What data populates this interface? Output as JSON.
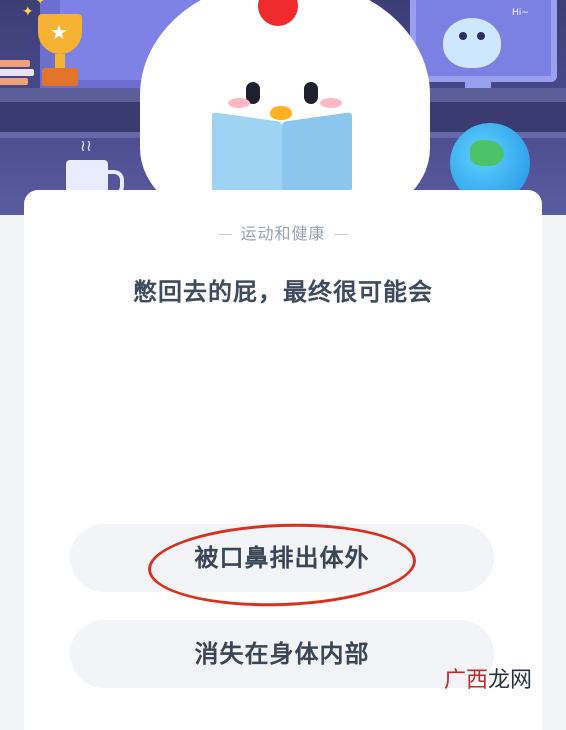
{
  "banner": {
    "monitor_greeting": "Hi~"
  },
  "quiz": {
    "category": "运动和健康",
    "question": "憋回去的屁，最终很可能会",
    "options": [
      {
        "label": "被口鼻排出体外",
        "circled": true
      },
      {
        "label": "消失在身体内部",
        "circled": false
      }
    ]
  },
  "watermark": {
    "part1": "广西",
    "part2": "龙网"
  },
  "colors": {
    "scene_bg": "#4a4b8c",
    "card_bg": "#ffffff",
    "option_bg": "#f2f4f7",
    "circle_mark": "#d9301f",
    "text_primary": "#3e4b5e",
    "text_muted": "#9aa3b2"
  },
  "icons": [
    "trophy-icon",
    "star-icon",
    "mug-icon",
    "globe-icon",
    "robot-icon",
    "chicken-mascot"
  ]
}
